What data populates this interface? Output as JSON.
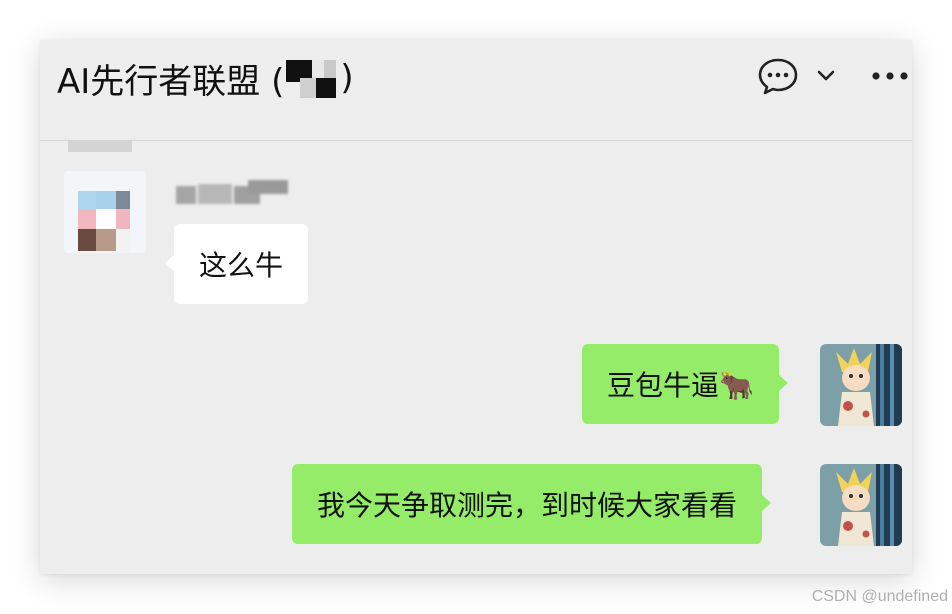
{
  "window": {
    "title_prefix": "AI先行者联盟 (",
    "title_suffix": ")"
  },
  "toolbar": {
    "chat_icon": "chat-bubble-icon",
    "chevron_icon": "chevron-down-icon",
    "more_icon": "more-dots-icon"
  },
  "messages": [
    {
      "direction": "incoming",
      "text": "这么牛"
    },
    {
      "direction": "outgoing",
      "text": "豆包牛逼🐂"
    },
    {
      "direction": "outgoing",
      "text": "我今天争取测完，到时候大家看看"
    }
  ],
  "watermark": "CSDN @undefined",
  "colors": {
    "window_bg": "#ededed",
    "incoming_bubble": "#ffffff",
    "outgoing_bubble": "#95ec69",
    "text": "#111111"
  }
}
